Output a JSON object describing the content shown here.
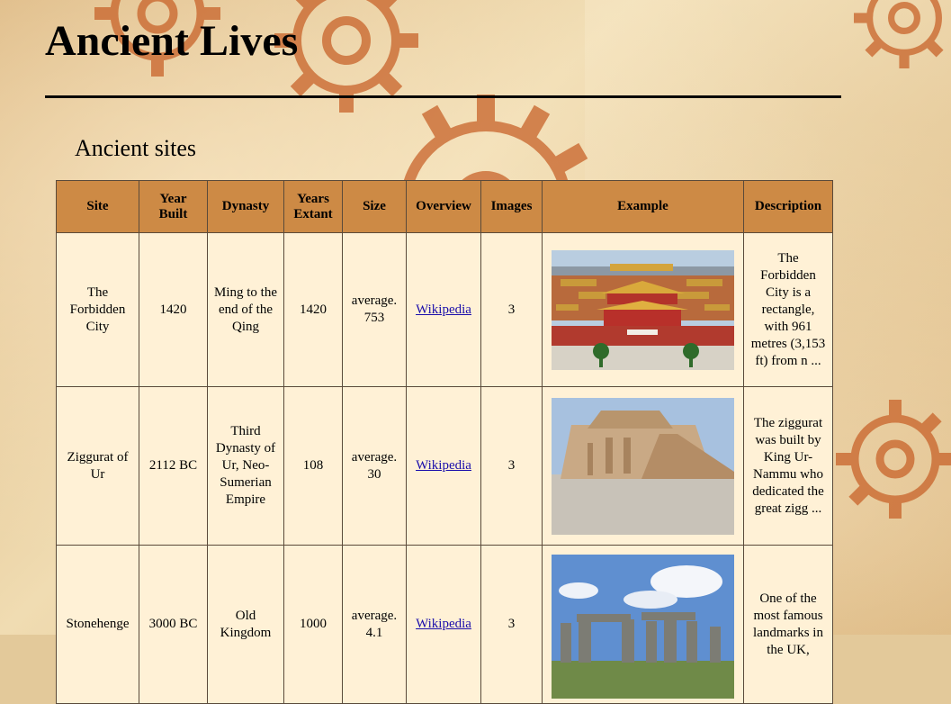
{
  "header": {
    "title": "Ancient Lives"
  },
  "section": {
    "title": "Ancient sites"
  },
  "table": {
    "columns": [
      "Site",
      "Year Built",
      "Dynasty",
      "Years Extant",
      "Size",
      "Overview",
      "Images",
      "Example",
      "Description"
    ],
    "rows": [
      {
        "site": "The Forbidden City",
        "year_built": "1420",
        "dynasty": "Ming to the end of the Qing",
        "years_extant": "1420",
        "size": "average. 753",
        "overview": "Wikipedia",
        "images": "3",
        "example": "forbidden-city-photo",
        "description": "The Forbidden City is a rectangle, with 961 metres (3,153 ft) from n ..."
      },
      {
        "site": "Ziggurat of Ur",
        "year_built": "2112 BC",
        "dynasty": "Third Dynasty of Ur, Neo-Sumerian Empire",
        "years_extant": "108",
        "size": "average. 30",
        "overview": "Wikipedia",
        "images": "3",
        "example": "ziggurat-photo",
        "description": "The ziggurat was built by King Ur-Nammu who dedicated the great zigg ..."
      },
      {
        "site": "Stonehenge",
        "year_built": "3000 BC",
        "dynasty": "Old Kingdom",
        "years_extant": "1000",
        "size": "average. 4.1",
        "overview": "Wikipedia",
        "images": "3",
        "example": "stonehenge-photo",
        "description": "One of the most famous landmarks in the UK,"
      }
    ]
  },
  "colors": {
    "header_bg": "#cd8a45",
    "cell_bg": "#fff1d6",
    "gear": "#c8632a"
  }
}
